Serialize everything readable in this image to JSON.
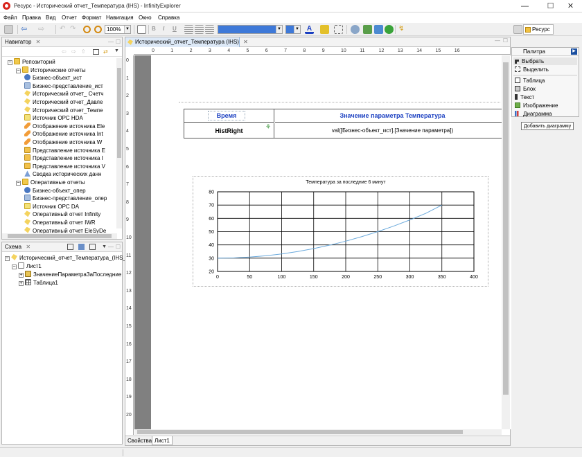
{
  "window": {
    "title": "Ресурс - Исторический отчет_Температура (IHS) - InfinityExplorer",
    "controls": {
      "minimize": "—",
      "maximize": "☐",
      "close": "✕"
    }
  },
  "menu": [
    "Файл",
    "Правка",
    "Вид",
    "Отчет",
    "Формат",
    "Навигация",
    "Окно",
    "Справка"
  ],
  "toolbar": {
    "zoom": "100%",
    "format_buttons": [
      "B",
      "I",
      "U"
    ],
    "perspective_label": "Ресурс"
  },
  "navigator": {
    "title": "Навигатор",
    "items": [
      {
        "label": "Репозиторий",
        "icon": "folder-icon",
        "level": 0,
        "expander": "−"
      },
      {
        "label": "Исторические отчеты",
        "icon": "folder-icon",
        "level": 1,
        "expander": "−"
      },
      {
        "label": "Бизнес-объект_ист",
        "icon": "gear-icon",
        "level": 2
      },
      {
        "label": "Бизнес-представление_ист",
        "icon": "business-view-icon",
        "level": 2
      },
      {
        "label": "Исторический отчет_ Счетч",
        "icon": "report-icon",
        "level": 2
      },
      {
        "label": "Исторический отчет_Давле",
        "icon": "report-icon",
        "level": 2
      },
      {
        "label": "Исторический отчет_Темпе",
        "icon": "report-icon",
        "level": 2
      },
      {
        "label": "Источник OPC HDA",
        "icon": "source-icon",
        "level": 2
      },
      {
        "label": "Отображение источника Ele",
        "icon": "mapping-icon",
        "level": 2
      },
      {
        "label": "Отображение источника Int",
        "icon": "mapping-icon",
        "level": 2
      },
      {
        "label": "Отображение источника W",
        "icon": "mapping-icon",
        "level": 2
      },
      {
        "label": "Представление источника E",
        "icon": "presentation-icon",
        "level": 2
      },
      {
        "label": "Представление источника I",
        "icon": "presentation-icon",
        "level": 2
      },
      {
        "label": "Представление источника V",
        "icon": "presentation-icon",
        "level": 2
      },
      {
        "label": "Сводка исторических данн",
        "icon": "summary-icon",
        "level": 2
      },
      {
        "label": "Оперативные отчеты",
        "icon": "folder-icon",
        "level": 1,
        "expander": "−"
      },
      {
        "label": "Бизнес-объект_опер",
        "icon": "gear-icon",
        "level": 2
      },
      {
        "label": "Бизнес-представление_опер",
        "icon": "business-view-icon",
        "level": 2
      },
      {
        "label": "Источник OPC DA",
        "icon": "source-icon",
        "level": 2
      },
      {
        "label": "Оперативный отчет Infinity",
        "icon": "report-icon",
        "level": 2
      },
      {
        "label": "Оперативный отчет IWR",
        "icon": "report-icon",
        "level": 2
      },
      {
        "label": "Оперативный отчет EleSyDe",
        "icon": "report-icon",
        "level": 2
      }
    ]
  },
  "schema": {
    "title": "Схема",
    "items": [
      {
        "label": "Исторический_отчет_Температура_(IHS_",
        "icon": "report-icon",
        "level": 0,
        "expander": "−"
      },
      {
        "label": "Лист1",
        "icon": "page-icon",
        "level": 1,
        "expander": "−"
      },
      {
        "label": "ЗначениеПараметраЗаПоследние",
        "icon": "value-icon",
        "level": 2,
        "expander": "+"
      },
      {
        "label": "Таблица1",
        "icon": "table-icon",
        "level": 2,
        "expander": "+"
      }
    ]
  },
  "editor": {
    "tab_label": "Исторический_отчет_Температура (IHS)",
    "ruler_top": [
      "0",
      "1",
      "2",
      "3",
      "4",
      "5",
      "6",
      "7",
      "8",
      "9",
      "10",
      "11",
      "12",
      "13",
      "14",
      "15",
      "16"
    ],
    "ruler_left": [
      "0",
      "1",
      "2",
      "3",
      "4",
      "5",
      "6",
      "7",
      "8",
      "9",
      "10",
      "11",
      "12",
      "13",
      "14",
      "15",
      "16",
      "17",
      "18",
      "19",
      "20"
    ],
    "table": {
      "header_time": "Время",
      "header_value": "Значение параметра Температура",
      "row_time": "HistRight",
      "row_value": "val([Бизнес-объект_ист].[Значение параметра])"
    },
    "bottom_tabs": [
      "Свойства",
      "Лист1"
    ]
  },
  "palette": {
    "title": "Палитра",
    "items": [
      {
        "label": "Выбрать",
        "icon": "cursor-icon"
      },
      {
        "label": "Выделить",
        "icon": "marquee-icon"
      },
      {
        "label": "Таблица",
        "icon": "table-icon"
      },
      {
        "label": "Блок",
        "icon": "block-icon"
      },
      {
        "label": "Текст",
        "icon": "text-icon"
      },
      {
        "label": "Изображение",
        "icon": "image-icon"
      },
      {
        "label": "Диаграмма",
        "icon": "chart-icon"
      }
    ],
    "tooltip": "Добавить диаграмму"
  },
  "colors": {
    "accent": "#1a3fc1",
    "selection": "#cce4f7",
    "line": "#6aa9dc",
    "tab_active": "#dde9f7"
  },
  "chart_data": {
    "type": "line",
    "title": "Температура за последние 6 минут",
    "xlim": [
      0,
      400
    ],
    "ylim": [
      20,
      80
    ],
    "xticks": [
      0,
      50,
      100,
      150,
      200,
      250,
      300,
      350,
      400
    ],
    "yticks": [
      20,
      30,
      40,
      50,
      60,
      70,
      80
    ],
    "grid": true,
    "series": [
      {
        "x": [
          0,
          25,
          50,
          75,
          100,
          125,
          150,
          175,
          200,
          225,
          250,
          275,
          300,
          325,
          350
        ],
        "y": [
          30,
          30.2,
          30.8,
          31.8,
          33.2,
          35,
          37.2,
          39.8,
          42.8,
          46.2,
          50,
          54.2,
          58.8,
          63.8,
          70
        ]
      }
    ]
  }
}
